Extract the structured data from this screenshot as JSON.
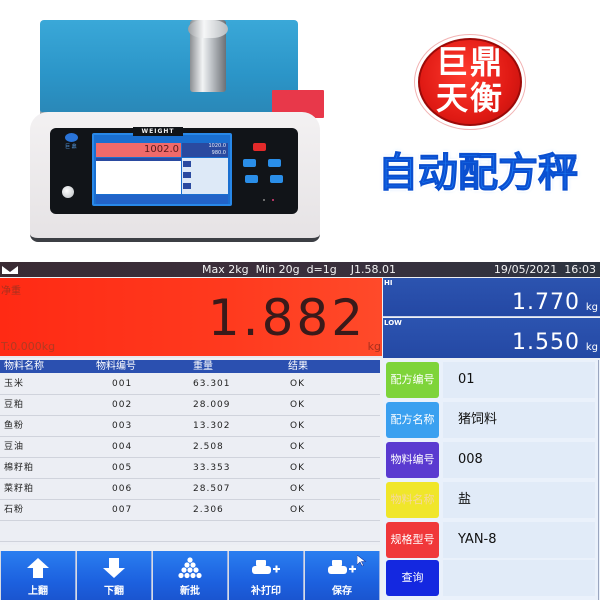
{
  "promo": {
    "brand_line1": "巨鼎",
    "brand_line2": "天衡",
    "product_title": "自动配方秤",
    "device_display_label": "WEIGHT",
    "device_display_value": "1002.0",
    "device_display_hi": "1020.0",
    "device_display_lo": "980.0",
    "device_logo_text": "巨 鼎"
  },
  "statusbar": {
    "menu_icon": "chevron-down-icon",
    "spec": "Max 2kg  Min 20g  d=1g    J1.58.01",
    "datetime": "19/05/2021  16:03"
  },
  "net": {
    "label": "净重",
    "value": "1.882",
    "unit": "kg",
    "tare": "T:0.000kg"
  },
  "limits": {
    "hi": {
      "label": "HI",
      "value": "1.770",
      "unit": "kg"
    },
    "low": {
      "label": "LOW",
      "value": "1.550",
      "unit": "kg"
    }
  },
  "table": {
    "headers": [
      "物料名称",
      "物料编号",
      "重量",
      "结果"
    ],
    "rows": [
      [
        "玉米",
        "001",
        "63.301",
        "OK"
      ],
      [
        "豆粕",
        "002",
        "28.009",
        "OK"
      ],
      [
        "鱼粉",
        "003",
        "13.302",
        "OK"
      ],
      [
        "豆油",
        "004",
        "2.508",
        "OK"
      ],
      [
        "棉籽粕",
        "005",
        "33.353",
        "OK"
      ],
      [
        "菜籽粕",
        "006",
        "28.507",
        "OK"
      ],
      [
        "石粉",
        "007",
        "2.306",
        "OK"
      ]
    ]
  },
  "toolbar": {
    "buttons": [
      {
        "label": "上翻",
        "icon": "arrow-up-icon"
      },
      {
        "label": "下翻",
        "icon": "arrow-down-icon"
      },
      {
        "label": "新批",
        "icon": "stack-icon"
      },
      {
        "label": "补打印",
        "icon": "printer-plus-icon"
      },
      {
        "label": "保存",
        "icon": "printer-plus-icon"
      }
    ]
  },
  "side": {
    "fields": [
      {
        "label": "配方编号",
        "value": "01",
        "color": "#7ed43a"
      },
      {
        "label": "配方名称",
        "value": "猪饲料",
        "color": "#3aa0f0"
      },
      {
        "label": "物料编号",
        "value": "008",
        "color": "#5a3ad0"
      },
      {
        "label": "物料名称",
        "value": "盐",
        "color": "#f0e62a"
      },
      {
        "label": "规格型号",
        "value": "YAN-8",
        "color": "#f0383a"
      }
    ],
    "query_label": "查询",
    "query_color": "#1428e0"
  },
  "colors": {
    "net_bg": "#ff3018",
    "limit_bg": "#2a4eac",
    "header_bg": "#2b50b0",
    "toolbar_bg": "#1f66e4"
  }
}
